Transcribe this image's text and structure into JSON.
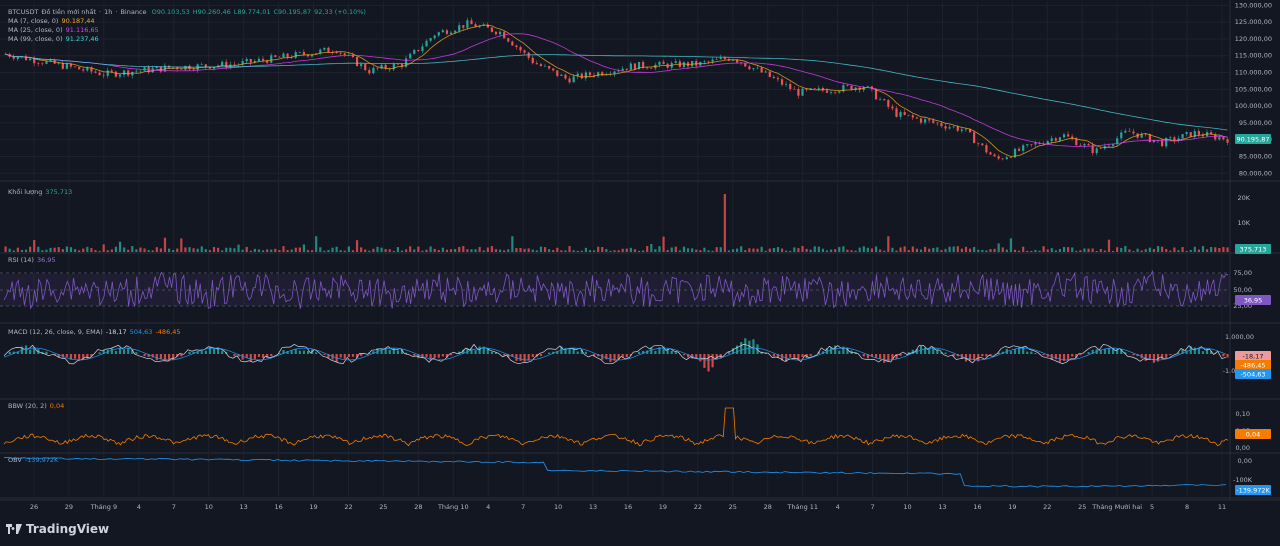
{
  "header": {
    "symbol": "BTCUSDT",
    "description": "Đồ tiền mới nhất",
    "interval": "1h",
    "exchange": "Binance",
    "ohlc": {
      "o": "O90.103,53",
      "h": "H90.260,46",
      "l": "L89.774,01",
      "c": "C90.195,87",
      "chg": "92,33 (+0.10%)"
    }
  },
  "ma_legend": [
    {
      "label": "MA (7, close, 0)",
      "value": "90.187,44",
      "color": "#f5a623"
    },
    {
      "label": "MA (25, close, 0)",
      "value": "91.116,65",
      "color": "#e040fb"
    },
    {
      "label": "MA (99, close, 0)",
      "value": "91.237,46",
      "color": "#4dd0e1"
    }
  ],
  "price_axis": {
    "ticks": [
      "130.000,00",
      "125.000,00",
      "120.000,00",
      "115.000,00",
      "110.000,00",
      "105.000,00",
      "100.000,00",
      "95.000,00",
      "90.000,00",
      "85.000,00",
      "80.000,00"
    ],
    "last": "90.195,87",
    "last_color": "#26a69a"
  },
  "volume": {
    "label": "Khối lượng",
    "value": "375,713",
    "ticks": [
      "20K",
      "10K"
    ],
    "last": "375,713"
  },
  "rsi": {
    "label": "RSI (14)",
    "value": "36,95",
    "ticks": [
      "75,00",
      "50,00",
      "25,00"
    ],
    "last": "36,95",
    "color": "#7e57c2"
  },
  "macd": {
    "label": "MACD (12, 26, close, 9, EMA)",
    "v1": "-18,17",
    "v2": "504,63",
    "v3": "-486,45",
    "ticks": [
      "1.000,00",
      "0,00",
      "-1.000,00"
    ],
    "last1": "-18,17",
    "last2": "-486,45",
    "last3": "-504,63"
  },
  "bbw": {
    "label": "BBW (20, 2)",
    "value": "0,04",
    "ticks": [
      "0,10",
      "0,05",
      "0,00"
    ],
    "last": "0,04",
    "color": "#f57c00"
  },
  "obv": {
    "label": "OBV",
    "value": "-139,972K",
    "ticks": [
      "0,00",
      "-100K"
    ],
    "last": "-139,972K",
    "color": "#2196f3"
  },
  "time_axis": [
    "26",
    "29",
    "Tháng 9",
    "4",
    "7",
    "10",
    "13",
    "16",
    "19",
    "22",
    "25",
    "28",
    "Tháng 10",
    "4",
    "7",
    "10",
    "13",
    "16",
    "19",
    "22",
    "25",
    "28",
    "Tháng 11",
    "4",
    "7",
    "10",
    "13",
    "16",
    "19",
    "22",
    "25",
    "Tháng Mười hai",
    "5",
    "8",
    "11"
  ],
  "brand": "TradingView",
  "colors": {
    "background": "#131722",
    "up": "#26a69a",
    "down": "#ef5350",
    "grid": "#1e222d"
  },
  "chart_data": {
    "type": "line",
    "title": "BTCUSDT · 1h · Binance",
    "ylim": [
      78000,
      131000
    ],
    "price_series": [
      {
        "x": 0,
        "y": 115500
      },
      {
        "x": 2,
        "y": 111500
      },
      {
        "x": 3,
        "y": 109500
      },
      {
        "x": 5,
        "y": 111500
      },
      {
        "x": 7,
        "y": 112500
      },
      {
        "x": 9,
        "y": 115500
      },
      {
        "x": 10,
        "y": 117000
      },
      {
        "x": 11,
        "y": 110500
      },
      {
        "x": 12,
        "y": 112500
      },
      {
        "x": 13,
        "y": 121500
      },
      {
        "x": 14,
        "y": 124500
      },
      {
        "x": 15,
        "y": 122000
      },
      {
        "x": 16,
        "y": 113000
      },
      {
        "x": 17,
        "y": 108000
      },
      {
        "x": 19,
        "y": 112000
      },
      {
        "x": 21,
        "y": 112500
      },
      {
        "x": 22,
        "y": 114500
      },
      {
        "x": 23,
        "y": 109500
      },
      {
        "x": 24,
        "y": 104000
      },
      {
        "x": 26,
        "y": 106000
      },
      {
        "x": 27,
        "y": 97500
      },
      {
        "x": 29,
        "y": 93000
      },
      {
        "x": 30,
        "y": 84000
      },
      {
        "x": 31,
        "y": 88000
      },
      {
        "x": 32,
        "y": 91500
      },
      {
        "x": 33,
        "y": 86500
      },
      {
        "x": 34,
        "y": 92500
      },
      {
        "x": 35,
        "y": 89000
      },
      {
        "x": 36,
        "y": 92000
      },
      {
        "x": 37,
        "y": 90200
      }
    ]
  }
}
